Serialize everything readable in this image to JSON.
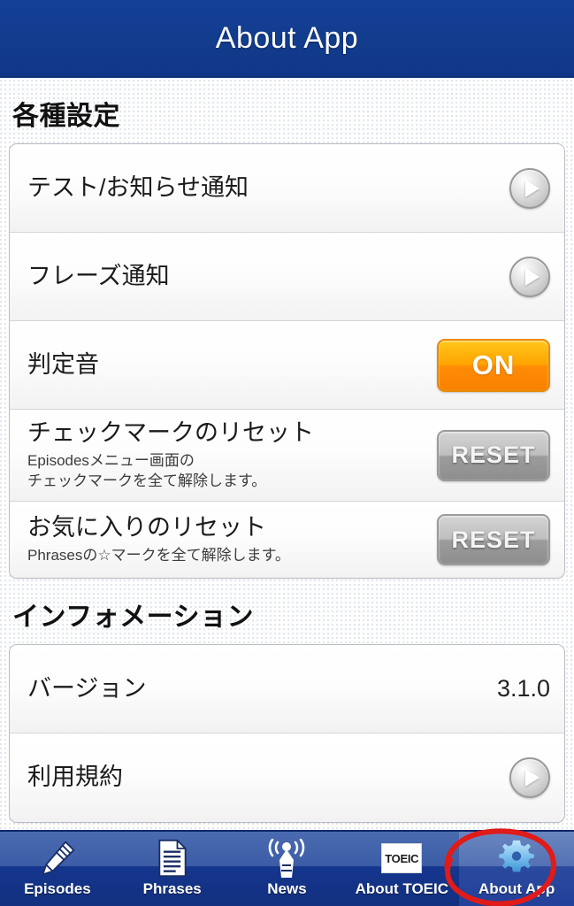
{
  "header": {
    "title": "About App"
  },
  "sections": [
    {
      "heading": "各種設定",
      "rows": [
        {
          "label": "テスト/お知らせ通知",
          "sub": "",
          "control": "play-icon",
          "value": ""
        },
        {
          "label": "フレーズ通知",
          "sub": "",
          "control": "play-icon",
          "value": ""
        },
        {
          "label": "判定音",
          "sub": "",
          "control": "on-button",
          "value": "ON"
        },
        {
          "label": "チェックマークのリセット",
          "sub": "Episodesメニュー画面の\nチェックマークを全て解除します。",
          "control": "reset-button",
          "value": "RESET"
        },
        {
          "label": "お気に入りのリセット",
          "sub": "Phrasesの☆マークを全て解除します。",
          "control": "reset-button",
          "value": "RESET"
        }
      ]
    },
    {
      "heading": "インフォメーション",
      "rows": [
        {
          "label": "バージョン",
          "sub": "",
          "control": "value-text",
          "value": "3.1.0"
        },
        {
          "label": "利用規約",
          "sub": "",
          "control": "play-icon",
          "value": ""
        }
      ]
    }
  ],
  "tabbar": {
    "tabs": [
      {
        "label": "Episodes",
        "icon": "pencil-icon",
        "active": false
      },
      {
        "label": "Phrases",
        "icon": "document-icon",
        "active": false
      },
      {
        "label": "News",
        "icon": "broadcast-tower-icon",
        "active": false
      },
      {
        "label": "About TOEIC",
        "icon": "toeic-logo-icon",
        "active": false,
        "logo_text": "TOEIC"
      },
      {
        "label": "About App",
        "icon": "gear-icon",
        "active": true
      }
    ]
  },
  "annotation": {
    "shape": "hand-drawn-red-ellipse",
    "color": "#e01b18",
    "target": "About App"
  },
  "colors": {
    "header_blue": "#123c8c",
    "tabbar_blue": "#15368e",
    "accent_orange": "#ffa400",
    "reset_gray": "#9c9c9c",
    "annotation_red": "#e01b18"
  }
}
